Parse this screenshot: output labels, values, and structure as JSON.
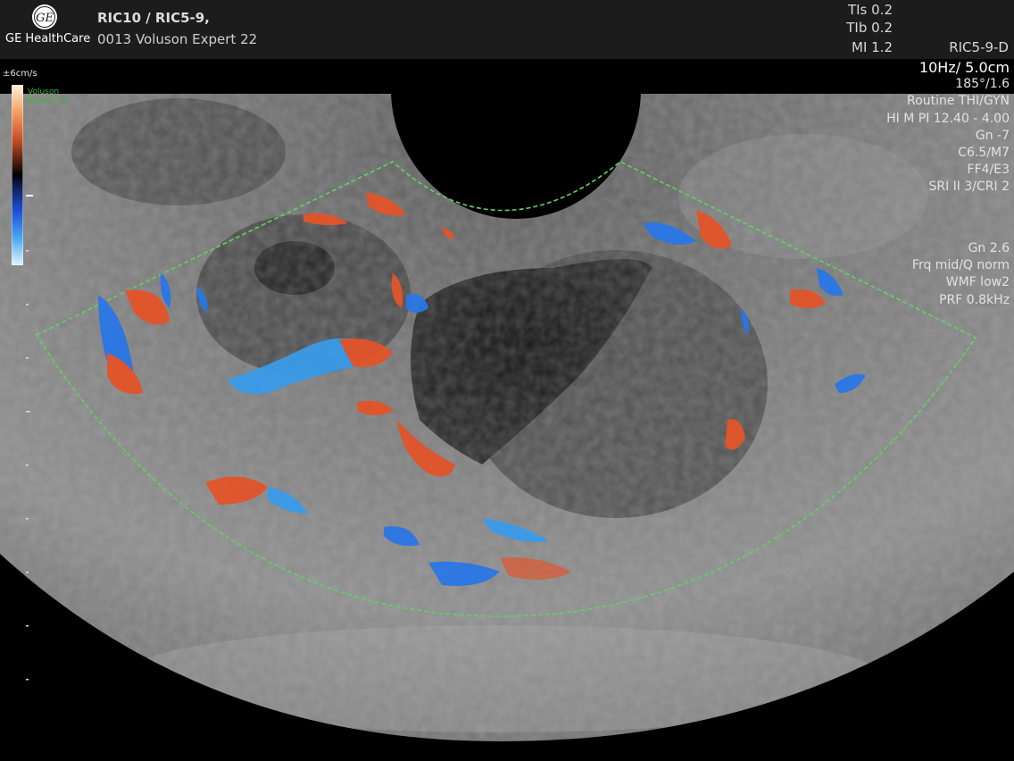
{
  "header": {
    "brand": "GE HealthCare",
    "logo_text": "GE",
    "title_line1": "RIC10 / RIC5-9,",
    "title_line2": "0013 Voluson Expert 22",
    "tis": "TIs  0.2",
    "tib": "TIb  0.2",
    "mi": "MI   1.2",
    "probe": "RIC5-9-D"
  },
  "params": {
    "frame_depth": "10Hz/ 5.0cm",
    "angle": "185°/1.6",
    "preset": "Routine THI/GYN",
    "harmonic": "HI M PI 12.40 - 4.00",
    "gain": "Gn  -7",
    "c_m": "C6.5/M7",
    "ff_e": "FF4/E3",
    "sri": "SRI II 3/CRI 2"
  },
  "color_params": {
    "gain": "Gn  2.6",
    "freq": "Frq mid/Q norm",
    "wmf": "WMF low2",
    "prf": "PRF  0.8kHz"
  },
  "color_scale": {
    "label": "±6cm/s",
    "watermark_line1": "Voluson",
    "watermark_line2": "Expert 22"
  },
  "colors": {
    "roi_outline": "#5fd45f",
    "flow_red": "#e2542a",
    "flow_blue": "#2a76e6",
    "background": "#000000",
    "header": "#1c1c1c"
  }
}
